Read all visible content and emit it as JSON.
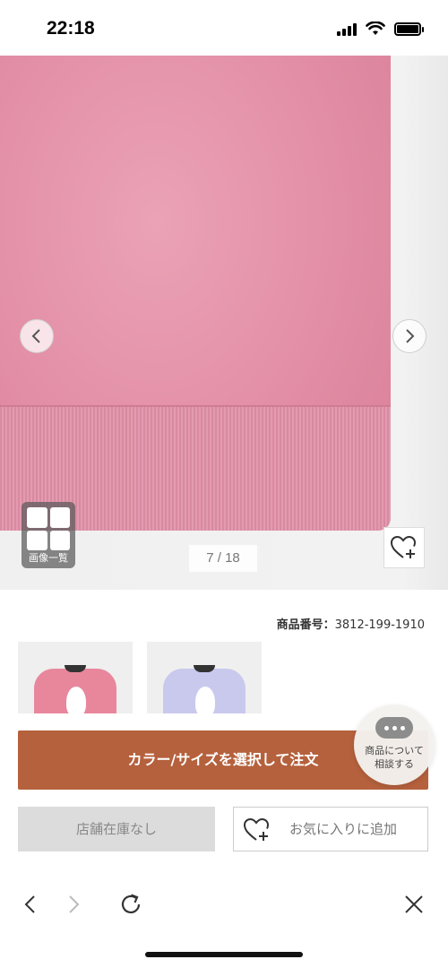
{
  "status_bar": {
    "time": "22:18",
    "icons": [
      "cellular-signal-icon",
      "wifi-icon",
      "battery-icon"
    ]
  },
  "product_image": {
    "counter": "7 / 18",
    "gallery_label": "画像一覧",
    "icons": [
      "chevron-left-icon",
      "chevron-right-icon",
      "grid-icon",
      "heart-plus-icon"
    ]
  },
  "product": {
    "number_label": "商品番号：",
    "number_value": "3812-199-1910"
  },
  "colors": {
    "thumbnails": [
      "pink",
      "lavender"
    ]
  },
  "actions": {
    "order_button": "カラー/サイズを選択して注文",
    "stock_button": "店舗在庫なし",
    "favorite_button": "お気に入りに追加"
  },
  "chat": {
    "line1": "商品について",
    "line2": "相談する"
  },
  "browser_toolbar": {
    "icons": [
      "back-icon",
      "forward-icon",
      "reload-icon",
      "close-icon"
    ]
  },
  "theme": {
    "accent": "#b5613d",
    "product_pink": "#e28ea6",
    "disabled_gray": "#dcdcdc"
  }
}
